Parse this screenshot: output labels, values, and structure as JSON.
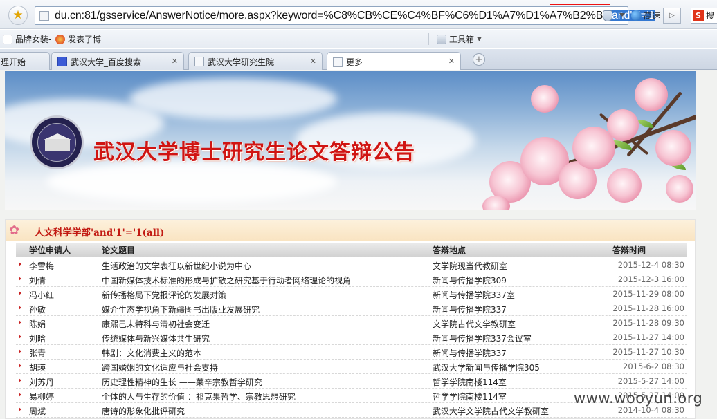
{
  "browser": {
    "url_plain": "du.cn:81/gsservice/AnswerNotice/more.aspx?keyword=%C8%CB%CE%C4%BF%C6%D1%A7%D1%A7%B2%BF",
    "url_selected": "'and'1'='1",
    "speed_label": "高速",
    "favorites": [
      "品牌女装-",
      "发表了博"
    ],
    "toolbox_label": "工具箱",
    "tabs": [
      {
        "label": "理开始"
      },
      {
        "label": "武汉大学_百度搜索"
      },
      {
        "label": "武汉大学研究生院"
      },
      {
        "label": "更多"
      }
    ],
    "colors": {
      "selection": "#3478d1",
      "highlight_box": "#e11111"
    }
  },
  "banner": {
    "title": "武汉大学博士研究生论文答辩公告",
    "logo_text": "WUHAN UNIVERSITY"
  },
  "section": {
    "title": "人文科学学部'and'1'='1(all)",
    "columns": [
      "学位申请人",
      "论文题目",
      "答辩地点",
      "答辩时间"
    ],
    "rows": [
      {
        "name": "李雪梅",
        "title": "生活政治的文学表征以新世纪小说为中心",
        "place": "文学院现当代教研室",
        "time": "2015-12-4 08:30"
      },
      {
        "name": "刘倩",
        "title": "中国新媒体技术标准的形成与扩散之研究基于行动者网络理论的视角",
        "place": "新闻与传播学院309",
        "time": "2015-12-3 16:00"
      },
      {
        "name": "冯小红",
        "title": "新传播格局下党报评论的发展对策",
        "place": "新闻与传播学院337室",
        "time": "2015-11-29 08:00"
      },
      {
        "name": "孙敏",
        "title": "媒介生态学视角下新疆图书出版业发展研究",
        "place": "新闻与传播学院337",
        "time": "2015-11-28 16:00"
      },
      {
        "name": "陈娟",
        "title": "康熙己未特科与清初社会变迁",
        "place": "文学院古代文学教研室",
        "time": "2015-11-28 09:30"
      },
      {
        "name": "刘晗",
        "title": "传统媒体与新兴媒体共生研究",
        "place": "新闻与传播学院337会议室",
        "time": "2015-11-27 14:00"
      },
      {
        "name": "张青",
        "title": "韩剧：文化消费主义的范本",
        "place": "新闻与传播学院337",
        "time": "2015-11-27 10:30"
      },
      {
        "name": "胡瑛",
        "title": "跨国婚姻的文化适应与社会支持",
        "place": "武汉大学新闻与传播学院305",
        "time": "2015-6-2 08:30"
      },
      {
        "name": "刘苏丹",
        "title": "历史理性精神的生长 ——莱辛宗教哲学研究",
        "place": "哲学学院南楼114室",
        "time": "2015-5-27 14:00"
      },
      {
        "name": "易柳婷",
        "title": "个体的人与生存的价值 ：祁克果哲学、宗教思想研究",
        "place": "哲学学院南楼114室",
        "time": "2015-5-27 14:00"
      },
      {
        "name": "周斌",
        "title": "唐诗的形象化批评研究",
        "place": "武汉大学文学院古代文学教研室",
        "time": "2014-10-4 08:30"
      }
    ]
  },
  "watermark": "www.wooyun.org"
}
